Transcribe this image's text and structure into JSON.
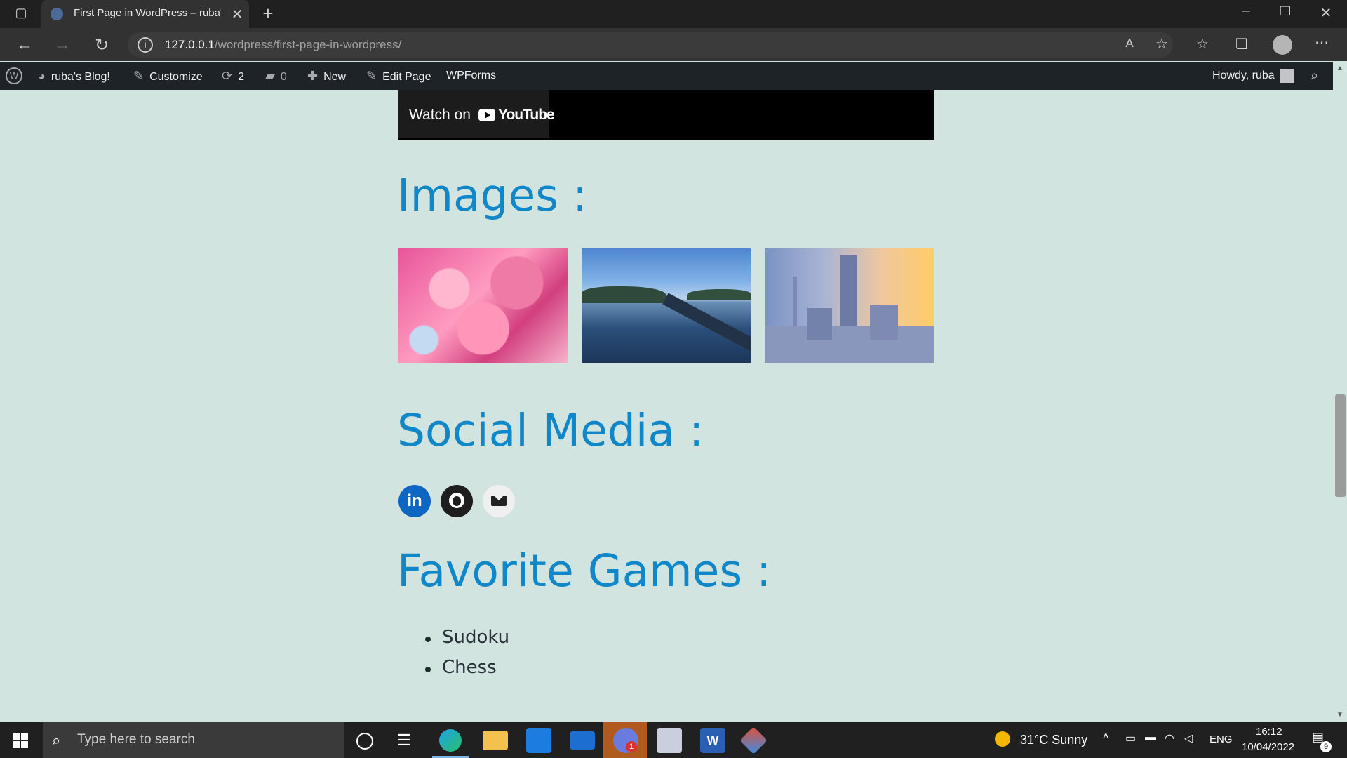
{
  "browser": {
    "tab_title": "First Page in WordPress – ruba's",
    "url_host": "127.0.0.1",
    "url_path": "/wordpress/first-page-in-wordpress/"
  },
  "adminbar": {
    "site_name": "ruba's Blog!",
    "customize": "Customize",
    "updates_count": "2",
    "comments_count": "0",
    "new_label": "New",
    "edit_page": "Edit Page",
    "wpforms": "WPForms",
    "howdy": "Howdy, ruba"
  },
  "video": {
    "watch_on": "Watch on",
    "brand": "YouTube"
  },
  "sections": {
    "images_heading": "Images :",
    "social_heading": "Social Media :",
    "games_heading": "Favorite Games :"
  },
  "social_links": [
    {
      "name": "LinkedIn",
      "icon": "linkedin-icon"
    },
    {
      "name": "GitHub",
      "icon": "github-icon"
    },
    {
      "name": "Email",
      "icon": "mail-icon"
    }
  ],
  "games": [
    "Sudoku",
    "Chess"
  ],
  "taskbar": {
    "search_placeholder": "Type here to search",
    "weather": "31°C  Sunny",
    "language": "ENG",
    "time": "16:12",
    "date": "10/04/2022",
    "notifications": "9",
    "chat_badge": "1"
  }
}
